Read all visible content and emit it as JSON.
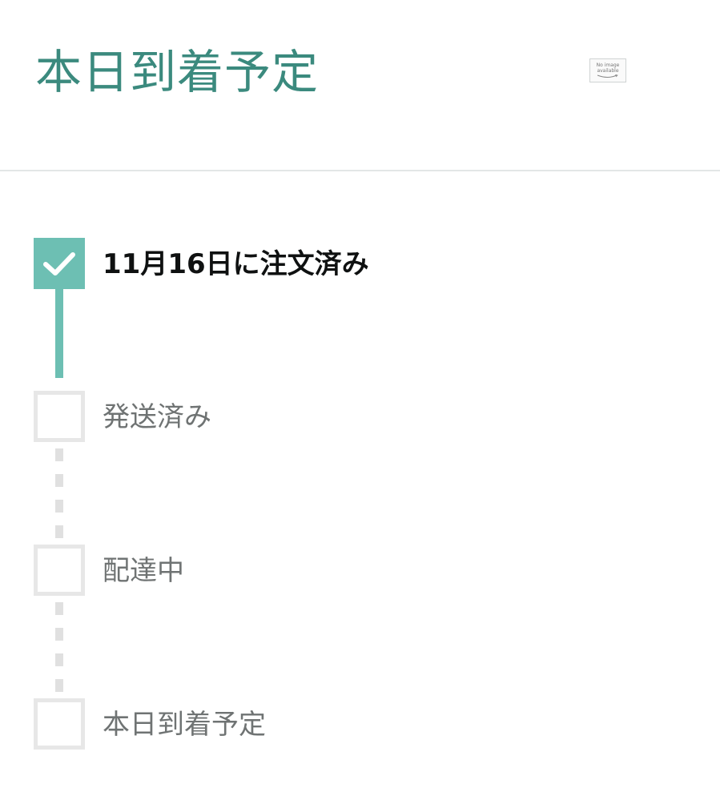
{
  "header": {
    "status_title": "本日到着予定",
    "thumbnail": {
      "line1": "No image",
      "line2": "available"
    }
  },
  "tracker": {
    "steps": [
      {
        "label": "11月16日に注文済み",
        "state": "done",
        "icon": "checkmark-icon"
      },
      {
        "label": "発送済み",
        "state": "pending",
        "icon": "empty-box"
      },
      {
        "label": "配達中",
        "state": "pending",
        "icon": "empty-box"
      },
      {
        "label": "本日到着予定",
        "state": "pending",
        "icon": "empty-box"
      }
    ]
  },
  "colors": {
    "accent": "#3b8a7e",
    "done": "#6dbfb3",
    "pending_border": "#e7e7e7",
    "divider": "#e3e6e6",
    "text_dark": "#0f1111",
    "text_muted": "#6f7373"
  }
}
